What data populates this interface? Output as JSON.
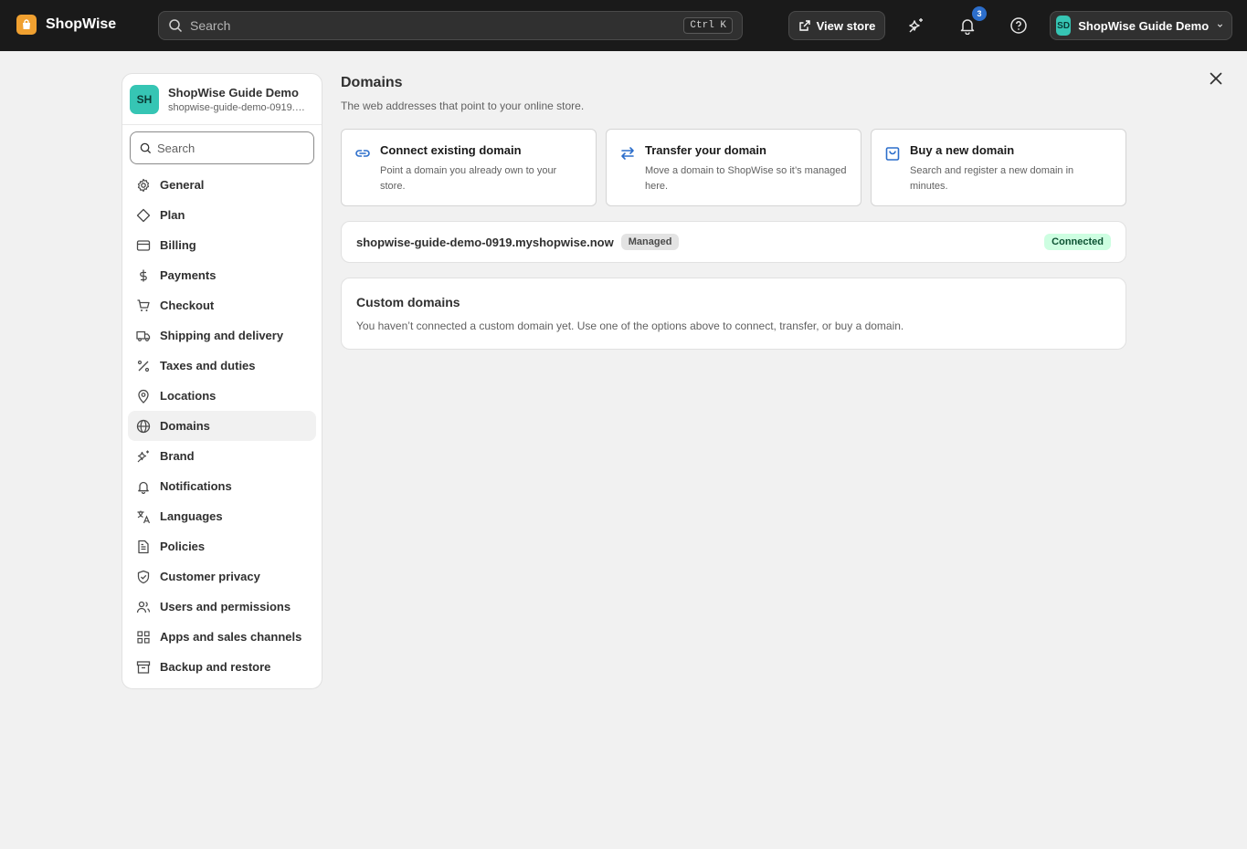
{
  "app": {
    "name": "ShopWise"
  },
  "search": {
    "placeholder": "Search",
    "shortcut": "Ctrl K"
  },
  "header": {
    "view_store_label": "View store",
    "notification_count": "3",
    "account_initials": "SD",
    "account_name": "ShopWise Guide Demo"
  },
  "store": {
    "initials": "SH",
    "name": "ShopWise Guide Demo",
    "domain": "shopwise-guide-demo-0919.myshopwise.now"
  },
  "sidebar": {
    "search_placeholder": "Search",
    "items": [
      {
        "label": "General",
        "icon": "gear-icon"
      },
      {
        "label": "Plan",
        "icon": "diamond-icon"
      },
      {
        "label": "Billing",
        "icon": "credit-card-icon"
      },
      {
        "label": "Payments",
        "icon": "dollar-icon"
      },
      {
        "label": "Checkout",
        "icon": "cart-icon"
      },
      {
        "label": "Shipping and delivery",
        "icon": "truck-icon"
      },
      {
        "label": "Taxes and duties",
        "icon": "percent-icon"
      },
      {
        "label": "Locations",
        "icon": "location-pin-icon"
      },
      {
        "label": "Domains",
        "icon": "globe-icon",
        "active": true
      },
      {
        "label": "Brand",
        "icon": "sparkle-icon"
      },
      {
        "label": "Notifications",
        "icon": "bell-icon"
      },
      {
        "label": "Languages",
        "icon": "translate-icon"
      },
      {
        "label": "Policies",
        "icon": "document-icon"
      },
      {
        "label": "Customer privacy",
        "icon": "shield-check-icon"
      },
      {
        "label": "Users and permissions",
        "icon": "users-icon"
      },
      {
        "label": "Apps and sales channels",
        "icon": "apps-grid-icon"
      },
      {
        "label": "Backup and restore",
        "icon": "archive-icon"
      }
    ]
  },
  "main": {
    "title": "Domains",
    "subtitle": "The web addresses that point to your online store.",
    "cards": [
      {
        "title": "Connect existing domain",
        "desc": "Point a domain you already own to your store.",
        "icon": "link-icon"
      },
      {
        "title": "Transfer your domain",
        "desc": "Move a domain to ShopWise so it’s managed here.",
        "icon": "transfer-arrows-icon"
      },
      {
        "title": "Buy a new domain",
        "desc": "Search and register a new domain in minutes.",
        "icon": "shopping-bag-icon"
      }
    ],
    "primary_domain": {
      "name": "shopwise-guide-demo-0919.myshopwise.now",
      "badge": "Managed",
      "status": "Connected"
    },
    "custom_domains": {
      "title": "Custom domains",
      "desc": "You haven’t connected a custom domain yet. Use one of the options above to connect, transfer, or buy a domain."
    }
  },
  "colors": {
    "topbar": "#1a1a1a",
    "accent_blue": "#2c6ecb",
    "avatar": "#36c5b4",
    "connected_bg": "#cdfee1",
    "connected_text": "#0c5132"
  }
}
